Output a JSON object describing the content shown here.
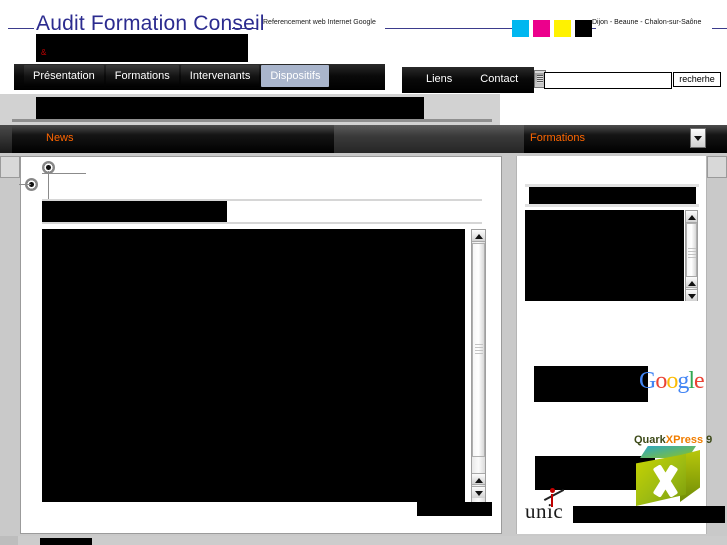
{
  "header": {
    "brand_part1": "Audit",
    "brand_part2": "Formation Conseil",
    "tagline": "Referencement web Internet Google",
    "cities": "Dijon - Beaune  - Chalon-sur-Saône",
    "ampersand": "&",
    "swatches": [
      {
        "name": "cyan",
        "hex": "#00b7f0"
      },
      {
        "name": "magenta",
        "hex": "#ec008c"
      },
      {
        "name": "yellow",
        "hex": "#fff200"
      },
      {
        "name": "black",
        "hex": "#000000"
      }
    ]
  },
  "nav": {
    "tabs": [
      {
        "label": "Présentation",
        "active": false
      },
      {
        "label": "Formations",
        "active": false
      },
      {
        "label": "Intervenants",
        "active": false
      },
      {
        "label": "Dispositifs",
        "active": true
      }
    ],
    "right_tabs": [
      {
        "label": "Liens"
      },
      {
        "label": "Contact"
      }
    ]
  },
  "search": {
    "value": "",
    "placeholder": "",
    "button_label": "recherhe"
  },
  "bars": {
    "news_label": "News",
    "formations_label": "Formations",
    "text_color": "#ff6600"
  },
  "sidebar": {
    "google_logo": {
      "letters": [
        "G",
        "o",
        "o",
        "g",
        "l",
        "e"
      ],
      "colors": [
        "#4285f4",
        "#ea4335",
        "#fbbc05",
        "#4285f4",
        "#34a853",
        "#ea4335"
      ]
    },
    "quark": {
      "part1": "Quark",
      "part2": "XPress",
      "part3": " 9"
    },
    "unic_label": "unic"
  },
  "colors": {
    "brand_blue": "#2b2b8f",
    "accent_orange": "#ff6600",
    "tab_active_bg": "#a9b5cc",
    "page_bg": "#c9c9c9",
    "redaction": "#000000"
  }
}
